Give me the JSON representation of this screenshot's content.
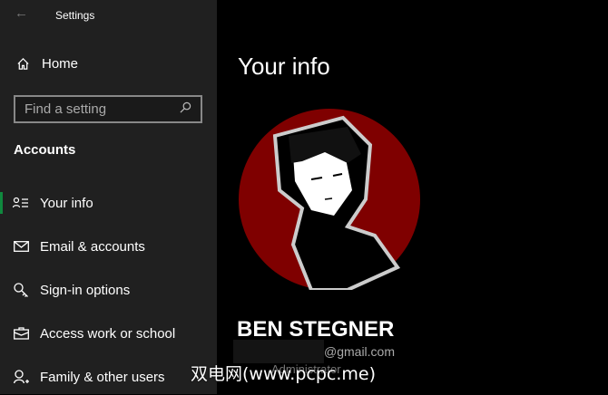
{
  "window": {
    "title": "Settings",
    "back_icon": "arrow-left-icon"
  },
  "sidebar": {
    "home": "Home",
    "search": {
      "placeholder": "Find a setting"
    },
    "section": "Accounts",
    "items": [
      {
        "label": "Your info",
        "icon": "person-list-icon",
        "active": true
      },
      {
        "label": "Email & accounts",
        "icon": "mail-icon"
      },
      {
        "label": "Sign-in options",
        "icon": "key-icon"
      },
      {
        "label": "Access work or school",
        "icon": "briefcase-icon"
      },
      {
        "label": "Family & other users",
        "icon": "person-add-icon"
      }
    ]
  },
  "main": {
    "title": "Your info",
    "user_name": "BEN STEGNER",
    "email": "@gmail.com",
    "role": "Administrator"
  },
  "watermark": "双电网(www.pcpc.me)",
  "colors": {
    "accent": "#10893e",
    "avatar_bg": "#7f0000"
  }
}
